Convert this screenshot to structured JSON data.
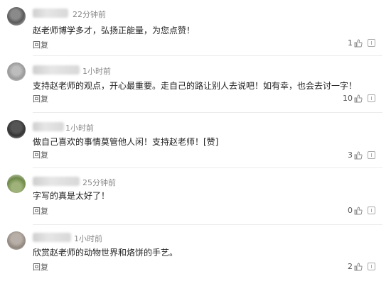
{
  "comments": [
    {
      "time": "22分钟前",
      "text": "赵老师博学多才，弘扬正能量，为您点赞！",
      "reply_label": "回复",
      "likes": "1"
    },
    {
      "time": "1小时前",
      "text": "支持赵老师的观点，开心最重要。走自己的路让别人去说吧！如有幸，也会去讨一字！",
      "reply_label": "回复",
      "likes": "10"
    },
    {
      "time": "1小时前",
      "text": "做自己喜欢的事情莫管他人闲！支持赵老师！[赞]",
      "reply_label": "回复",
      "likes": "3"
    },
    {
      "time": "25分钟前",
      "text": "字写的真是太好了！",
      "reply_label": "回复",
      "likes": "0"
    },
    {
      "time": "1小时前",
      "text": "欣赏赵老师的动物世界和烙饼的手艺。",
      "reply_label": "回复",
      "likes": "2"
    }
  ]
}
